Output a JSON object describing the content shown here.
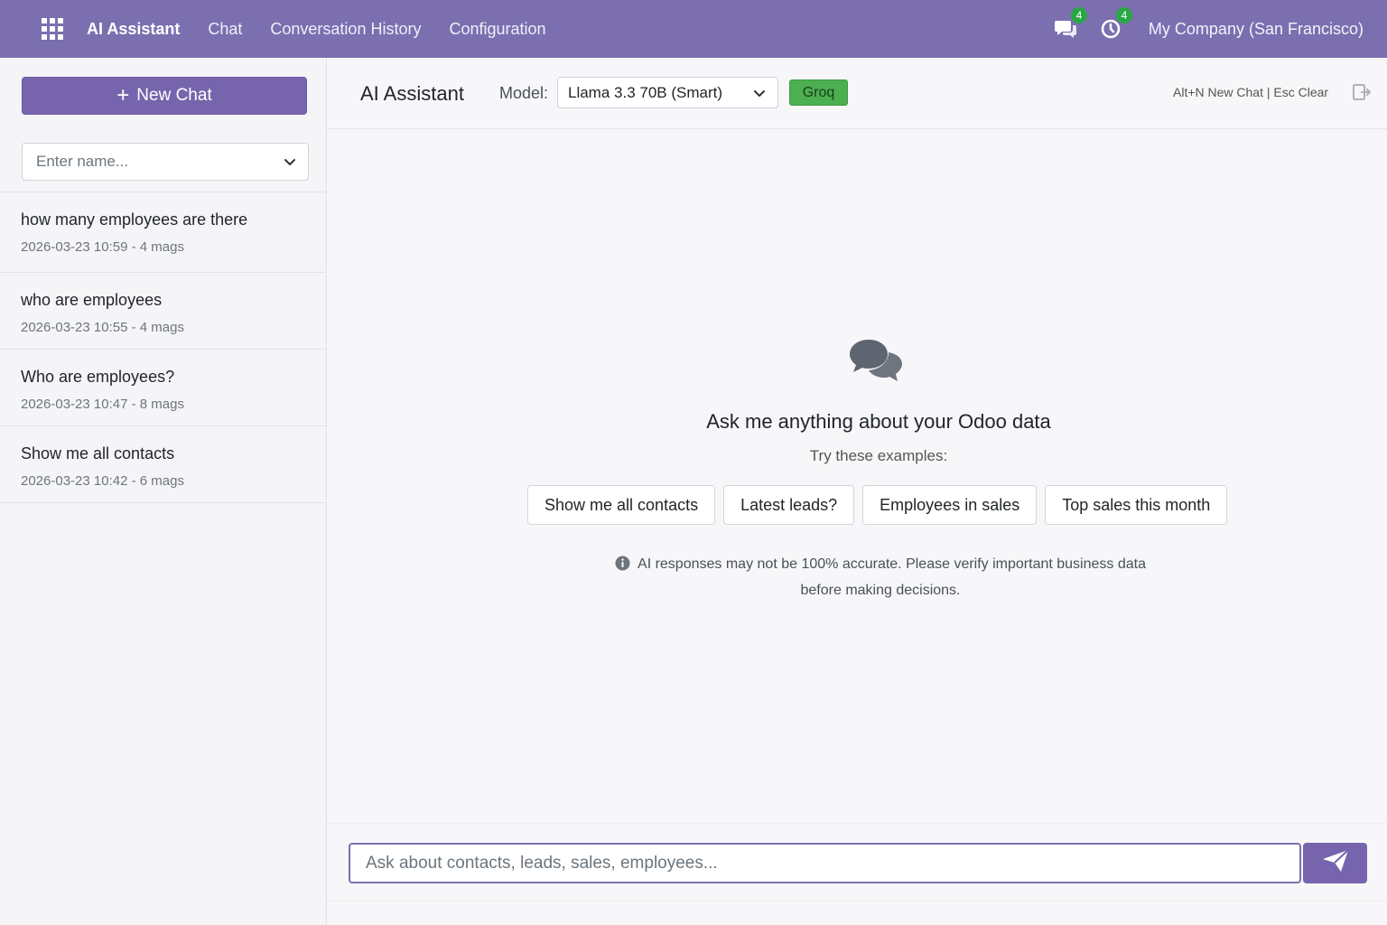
{
  "navbar": {
    "apps_icon": "grid-icon",
    "brand": "AI Assistant",
    "links": [
      "Chat",
      "Conversation History",
      "Configuration"
    ],
    "messages_badge": "4",
    "activity_badge": "4",
    "company": "My Company (San Francisco)"
  },
  "sidebar": {
    "new_chat_label": "New Chat",
    "name_placeholder": "Enter name...",
    "conversations": [
      {
        "title": "how many employees are there",
        "meta": "2026-03-23 10:59 - 4 mags"
      },
      {
        "title": "who are employees",
        "meta": "2026-03-23 10:55 - 4 mags"
      },
      {
        "title": "Who are employees?",
        "meta": "2026-03-23 10:47 - 8 mags"
      },
      {
        "title": "Show me all contacts",
        "meta": "2026-03-23 10:42 - 6 mags"
      }
    ]
  },
  "header": {
    "title": "AI Assistant",
    "model_label": "Model:",
    "model_value": "Llama 3.3 70B (Smart)",
    "provider": "Groq",
    "shortcuts": "Alt+N New Chat | Esc Clear"
  },
  "empty_state": {
    "title": "Ask me anything about your Odoo data",
    "subtitle": "Try these examples:",
    "examples": [
      "Show me all contacts",
      "Latest leads?",
      "Employees in sales",
      "Top sales this month"
    ],
    "disclaimer_line1": "AI responses may not be 100% accurate. Please verify important business data",
    "disclaimer_line2": "before making decisions."
  },
  "composer": {
    "placeholder": "Ask about contacts, leads, sales, employees..."
  },
  "colors": {
    "navbar": "#7b6fb0",
    "primary_button": "#7665ad",
    "badge_green": "#28a745",
    "provider_green": "#4caf50"
  }
}
